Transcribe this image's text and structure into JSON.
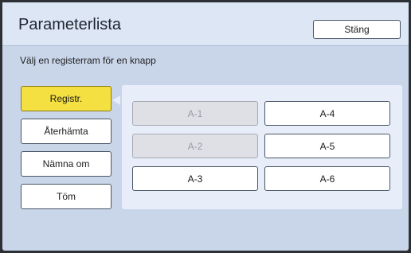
{
  "window": {
    "title": "Parameterlista",
    "close_label": "Stäng"
  },
  "instruction": "Välj en registerram för en knapp",
  "actions": {
    "register_label": "Registr.",
    "recall_label": "Återhämta",
    "rename_label": "Nämna om",
    "clear_label": "Töm",
    "active": "register"
  },
  "slots": [
    {
      "label": "A-1",
      "enabled": false
    },
    {
      "label": "A-2",
      "enabled": false
    },
    {
      "label": "A-3",
      "enabled": true
    },
    {
      "label": "A-4",
      "enabled": true
    },
    {
      "label": "A-5",
      "enabled": true
    },
    {
      "label": "A-6",
      "enabled": true
    }
  ],
  "colors": {
    "active_button": "#f4e041",
    "background": "#c9d6ea",
    "panel": "#e7eef9"
  }
}
